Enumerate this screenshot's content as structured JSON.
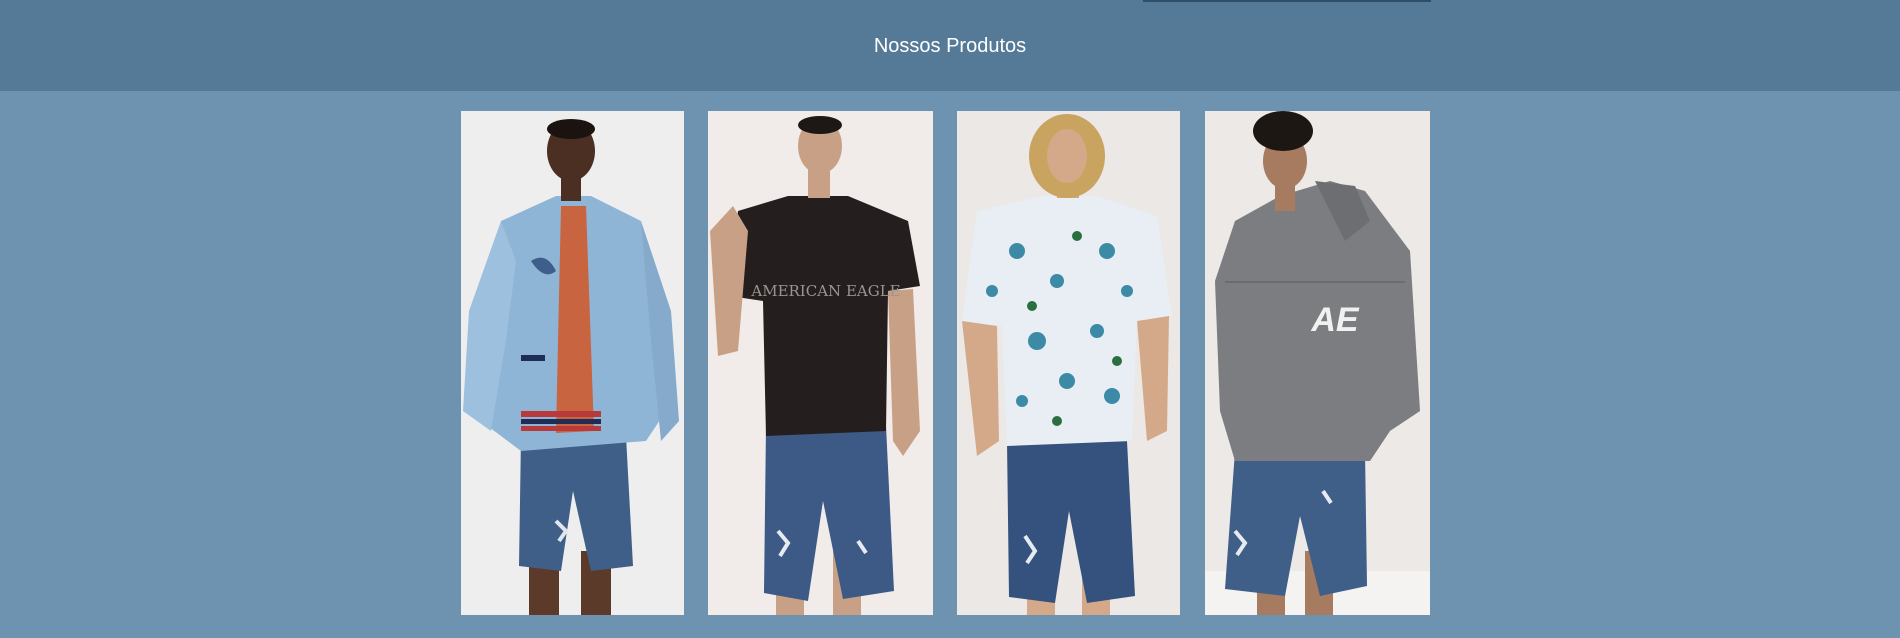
{
  "header": {
    "title": "Nossos Produtos"
  },
  "colors": {
    "page_background": "#6e93b0",
    "header_background": "#557a97"
  },
  "products": [
    {
      "name": "model-bomber-jacket",
      "icons": [
        "person-photo"
      ]
    },
    {
      "name": "model-black-tee",
      "shirt_text": "AMERICAN EAGLE"
    },
    {
      "name": "model-printed-shirt"
    },
    {
      "name": "model-grey-hoodie",
      "hoodie_logo": "AE"
    }
  ]
}
